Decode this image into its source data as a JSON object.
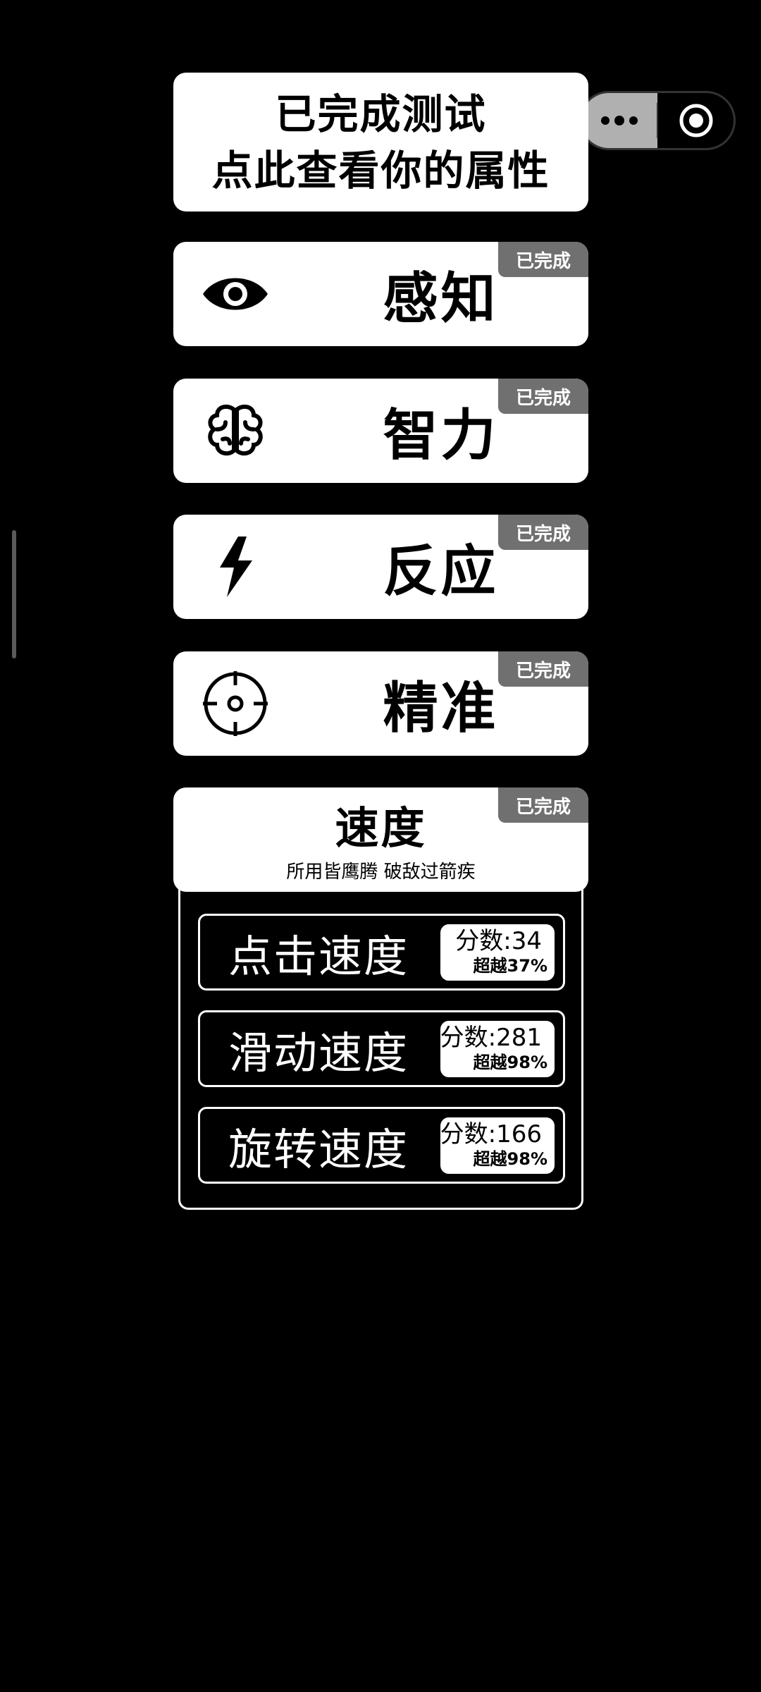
{
  "capsule": {
    "more_icon": "more-dots-icon",
    "close_icon": "target-circle-icon"
  },
  "header": {
    "line1": "已完成测试",
    "line2": "点此查看你的属性"
  },
  "attributes": [
    {
      "label": "感知",
      "icon": "eye-icon",
      "badge": "已完成"
    },
    {
      "label": "智力",
      "icon": "brain-icon",
      "badge": "已完成"
    },
    {
      "label": "反应",
      "icon": "lightning-icon",
      "badge": "已完成"
    },
    {
      "label": "精准",
      "icon": "crosshair-icon",
      "badge": "已完成"
    }
  ],
  "speed": {
    "title": "速度",
    "subtitle": "所用皆鹰腾 破敌过箭疾",
    "badge": "已完成",
    "rows": [
      {
        "label": "点击速度",
        "score": "分数:34",
        "rank": "超越37%"
      },
      {
        "label": "滑动速度",
        "score": "分数:281",
        "rank": "超越98%"
      },
      {
        "label": "旋转速度",
        "score": "分数:166",
        "rank": "超越98%"
      }
    ]
  }
}
